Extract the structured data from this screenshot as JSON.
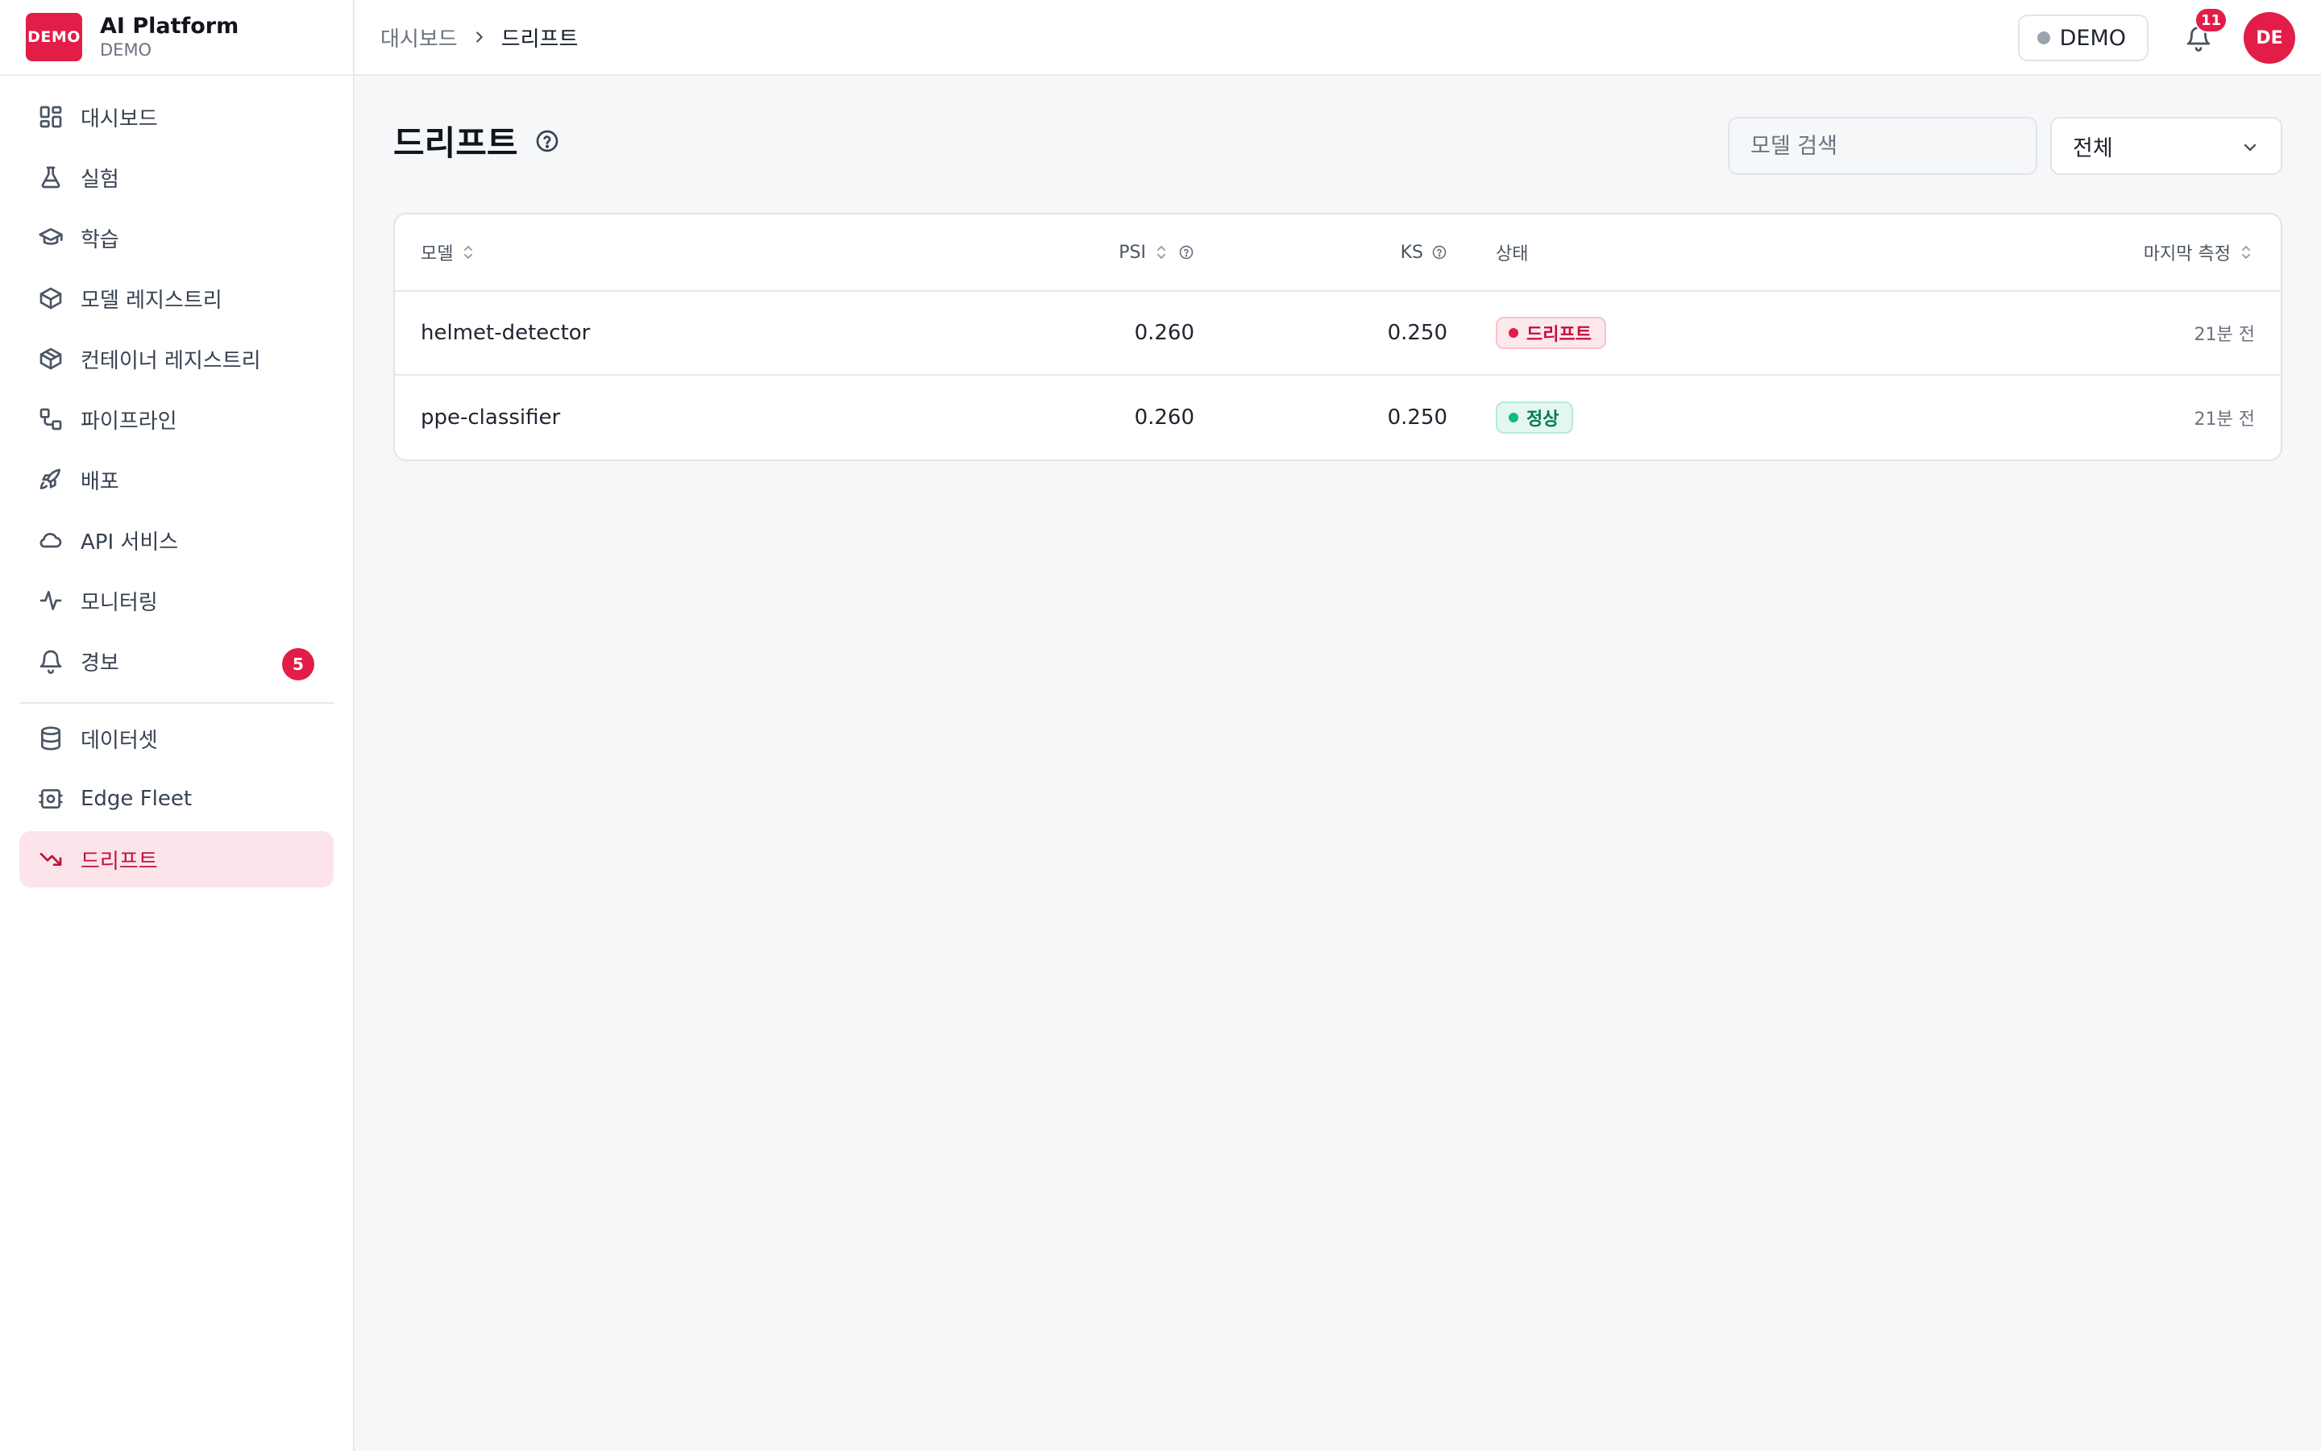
{
  "brand": {
    "logo_text": "DEMO",
    "title": "AI Platform",
    "subtitle": "DEMO"
  },
  "sidebar": {
    "items": [
      {
        "label": "대시보드",
        "icon": "dashboard-icon"
      },
      {
        "label": "실험",
        "icon": "flask-icon"
      },
      {
        "label": "학습",
        "icon": "graduation-cap-icon"
      },
      {
        "label": "모델 레지스트리",
        "icon": "box-icon"
      },
      {
        "label": "컨테이너 레지스트리",
        "icon": "package-icon"
      },
      {
        "label": "파이프라인",
        "icon": "workflow-icon"
      },
      {
        "label": "배포",
        "icon": "rocket-icon"
      },
      {
        "label": "API 서비스",
        "icon": "cloud-icon"
      },
      {
        "label": "모니터링",
        "icon": "activity-icon"
      },
      {
        "label": "경보",
        "icon": "bell-icon",
        "badge": "5"
      }
    ],
    "secondary_items": [
      {
        "label": "데이터셋",
        "icon": "database-icon"
      },
      {
        "label": "Edge Fleet",
        "icon": "edge-device-icon"
      },
      {
        "label": "드리프트",
        "icon": "trending-down-icon",
        "active": true
      }
    ]
  },
  "topbar": {
    "breadcrumb": {
      "home": "대시보드",
      "current": "드리프트"
    },
    "env_label": "DEMO",
    "notification_count": "11",
    "avatar_initials": "DE"
  },
  "page": {
    "title": "드리프트",
    "search": {
      "placeholder": "모델 검색",
      "value": ""
    },
    "filter": {
      "selected": "전체"
    }
  },
  "table": {
    "columns": {
      "model": "모델",
      "psi": "PSI",
      "ks": "KS",
      "status": "상태",
      "last_measured": "마지막 측정"
    },
    "rows": [
      {
        "model": "helmet-detector",
        "psi": "0.260",
        "ks": "0.250",
        "status": "드리프트",
        "status_type": "drift",
        "last_measured": "21분 전"
      },
      {
        "model": "ppe-classifier",
        "psi": "0.260",
        "ks": "0.250",
        "status": "정상",
        "status_type": "ok",
        "last_measured": "21분 전"
      }
    ]
  },
  "colors": {
    "accent": "#e11d48",
    "active_bg": "#fde4ea",
    "drift": "#be123c",
    "ok": "#047857"
  }
}
